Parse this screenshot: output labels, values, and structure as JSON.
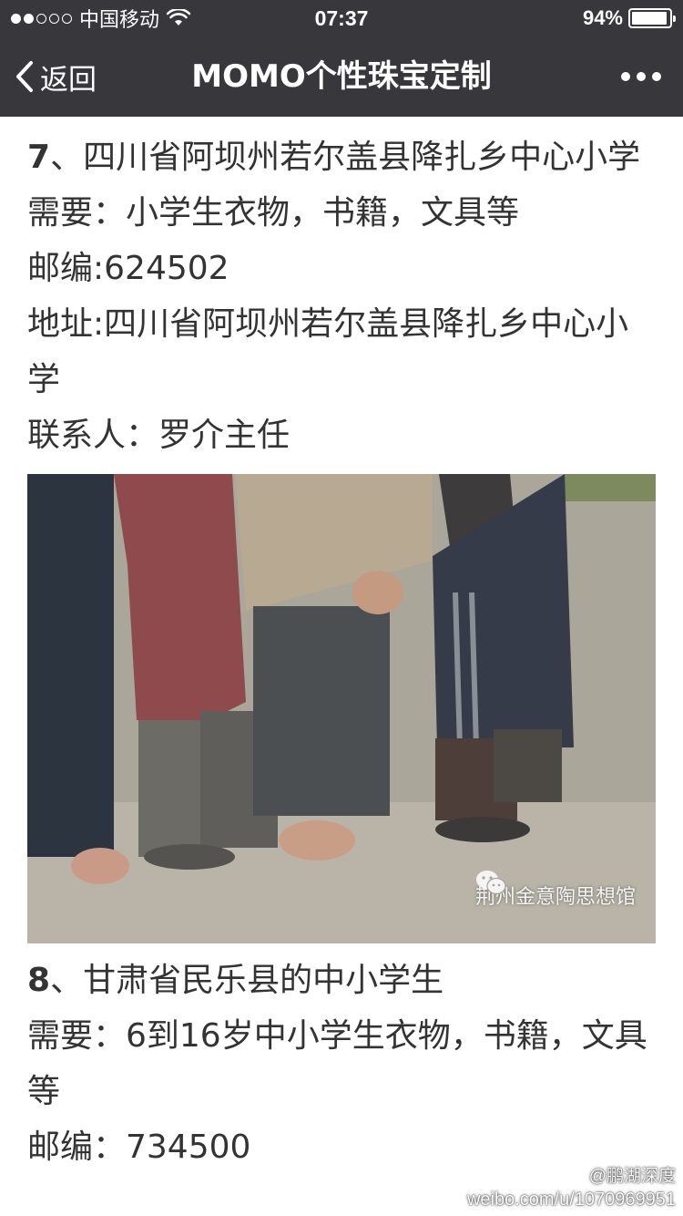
{
  "status_bar": {
    "carrier": "中国移动",
    "time": "07:37",
    "battery_percent": "94%",
    "battery_level": 0.94,
    "signal_bars_filled": 2,
    "signal_bars_total": 5
  },
  "nav": {
    "back_label": "返回",
    "title": "MOMO个性珠宝定制"
  },
  "article": {
    "sections": [
      {
        "number": "7",
        "title": "、四川省阿坝州若尔盖县降扎乡中心小学",
        "needs": "需要：小学生衣物，书籍，文具等",
        "postcode": "邮编:624502",
        "address": "地址:四川省阿坝州若尔盖县降扎乡中心小学",
        "contact": "联系人：罗介主任"
      },
      {
        "number": "8",
        "title": "、甘肃省民乐县的中小学生",
        "needs": "需要：6到16岁中小学生衣物，书籍，文具等",
        "postcode_partial": "邮编：734500"
      }
    ],
    "photo_watermark": "荆州金意陶思想馆"
  },
  "watermark": {
    "weibo_handle": "@鹏湖深度",
    "weibo_url": "weibo.com/u/1070969951"
  },
  "colors": {
    "bar_background": "#38373c",
    "text": "#333333",
    "page_background": "#ffffff"
  }
}
